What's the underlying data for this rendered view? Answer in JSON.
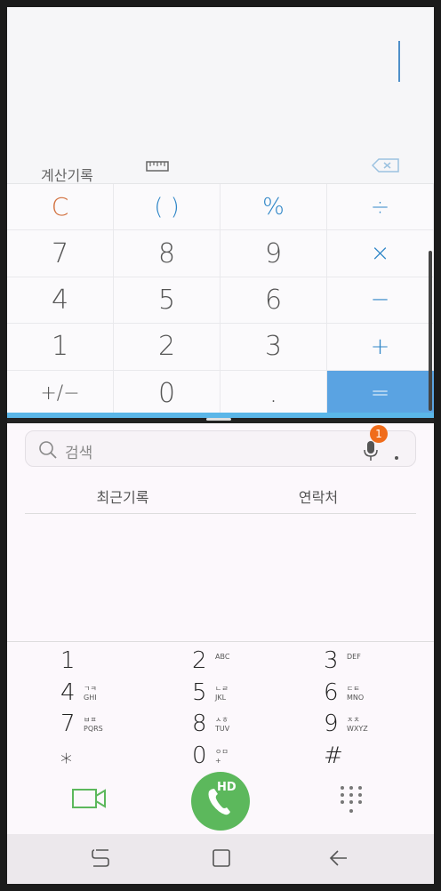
{
  "calculator": {
    "history_label": "계산기록",
    "keys": [
      {
        "label": "C",
        "type": "clr"
      },
      {
        "label": "( )",
        "type": "op"
      },
      {
        "label": "%",
        "type": "op"
      },
      {
        "label": "÷",
        "type": "op"
      },
      {
        "label": "7",
        "type": "num"
      },
      {
        "label": "8",
        "type": "num"
      },
      {
        "label": "9",
        "type": "num"
      },
      {
        "label": "×",
        "type": "op"
      },
      {
        "label": "4",
        "type": "num"
      },
      {
        "label": "5",
        "type": "num"
      },
      {
        "label": "6",
        "type": "num"
      },
      {
        "label": "−",
        "type": "op"
      },
      {
        "label": "1",
        "type": "num"
      },
      {
        "label": "2",
        "type": "num"
      },
      {
        "label": "3",
        "type": "num"
      },
      {
        "label": "+",
        "type": "op"
      },
      {
        "label": "+/−",
        "type": "small"
      },
      {
        "label": "0",
        "type": "num"
      },
      {
        "label": ".",
        "type": "num"
      },
      {
        "label": "=",
        "type": "eq"
      }
    ]
  },
  "phone": {
    "search_placeholder": "검색",
    "notification_count": "1",
    "tabs": [
      "최근기록",
      "연락처"
    ],
    "dialpad": [
      {
        "num": "1",
        "sub1": "",
        "sub2": ""
      },
      {
        "num": "2",
        "sub1": "ABC",
        "sub2": ""
      },
      {
        "num": "3",
        "sub1": "DEF",
        "sub2": ""
      },
      {
        "num": "4",
        "sub1": "ㄱㅋ",
        "sub2": "GHI"
      },
      {
        "num": "5",
        "sub1": "ㄴㄹ",
        "sub2": "JKL"
      },
      {
        "num": "6",
        "sub1": "ㄷㅌ",
        "sub2": "MNO"
      },
      {
        "num": "7",
        "sub1": "ㅂㅍ",
        "sub2": "PQRS"
      },
      {
        "num": "8",
        "sub1": "ㅅㅎ",
        "sub2": "TUV"
      },
      {
        "num": "9",
        "sub1": "ㅈㅊ",
        "sub2": "WXYZ"
      },
      {
        "num": "⁎",
        "sub1": "",
        "sub2": ""
      },
      {
        "num": "0",
        "sub1": "ㅇㅁ",
        "sub2": "+"
      },
      {
        "num": "#",
        "sub1": "",
        "sub2": ""
      }
    ],
    "call_label": "HD"
  },
  "colors": {
    "accent_blue": "#2f86c7",
    "equals_bg": "#5aa3e2",
    "clear_orange": "#d2703e",
    "call_green": "#5cb85c",
    "badge_orange": "#f06c1b"
  },
  "icons": [
    "ruler-icon",
    "backspace-icon",
    "search-icon",
    "mic-icon",
    "more-options-icon",
    "video-call-icon",
    "phone-icon",
    "keypad-icon",
    "recent-apps-icon",
    "home-icon",
    "back-icon"
  ]
}
